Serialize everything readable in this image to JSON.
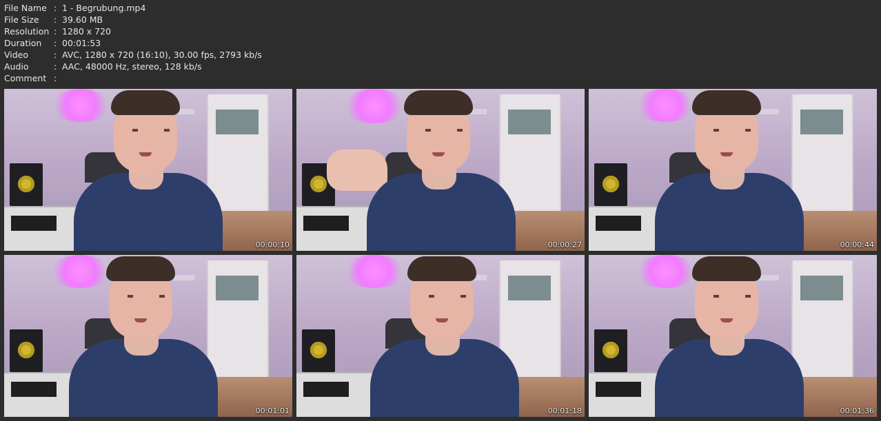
{
  "info": {
    "rows": [
      {
        "label": "File Name",
        "value": "1 - Begrubung.mp4"
      },
      {
        "label": "File Size",
        "value": "39.60 MB"
      },
      {
        "label": "Resolution",
        "value": "1280 x 720"
      },
      {
        "label": "Duration",
        "value": "00:01:53"
      },
      {
        "label": "Video",
        "value": "AVC, 1280 x 720 (16:10), 30.00 fps, 2793 kb/s"
      },
      {
        "label": "Audio",
        "value": "AAC, 48000 Hz, stereo, 128 kb/s"
      },
      {
        "label": "Comment",
        "value": ""
      }
    ],
    "separator": ":"
  },
  "thumbnails": [
    {
      "timestamp": "00:00:10"
    },
    {
      "timestamp": "00:00:27"
    },
    {
      "timestamp": "00:00:44"
    },
    {
      "timestamp": "00:01:01"
    },
    {
      "timestamp": "00:01:18"
    },
    {
      "timestamp": "00:01:36"
    }
  ]
}
